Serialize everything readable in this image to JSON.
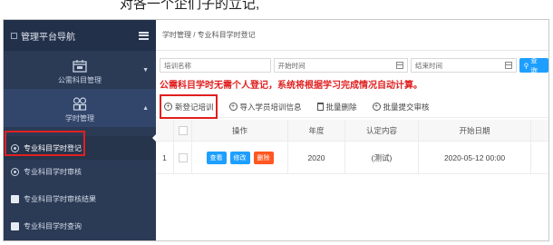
{
  "caption": "对各一个企们子的立记,",
  "sidebar": {
    "title": "管理平台导航",
    "sections": [
      {
        "label": "公需科目管理"
      },
      {
        "label": "学时管理"
      }
    ],
    "items": [
      {
        "label": "专业科目学时登记",
        "selected": true
      },
      {
        "label": "专业科目学时审核"
      },
      {
        "label": "专业科目学时审核结果"
      },
      {
        "label": "专业科目学时查询"
      }
    ]
  },
  "breadcrumb": "学时管理 / 专业科目学时登记",
  "filters": {
    "name_placeholder": "培训名称",
    "start_placeholder": "开始时间",
    "end_placeholder": "结束时间",
    "query_label": "查询"
  },
  "warning": "公需科目学时无需个人登记，系统将根据学习完成情况自动计算。",
  "toolbar": {
    "new_label": "新登记培训",
    "import_label": "导入学员培训信息",
    "batch_delete_label": "批量删除",
    "batch_submit_label": "批量提交审核"
  },
  "table": {
    "headers": {
      "ops": "操作",
      "year": "年度",
      "cert": "认定内容",
      "date": "开始日期"
    },
    "rows": [
      {
        "index": "1",
        "view": "查看",
        "edit": "修改",
        "del": "删除",
        "year": "2020",
        "cert": "(测试)",
        "date": "2020-05-12 00:00"
      }
    ]
  },
  "colors": {
    "sidebar": "#2b3a55",
    "accent": "#1e9fff",
    "danger": "#ff5722",
    "highlight": "#e02020"
  }
}
